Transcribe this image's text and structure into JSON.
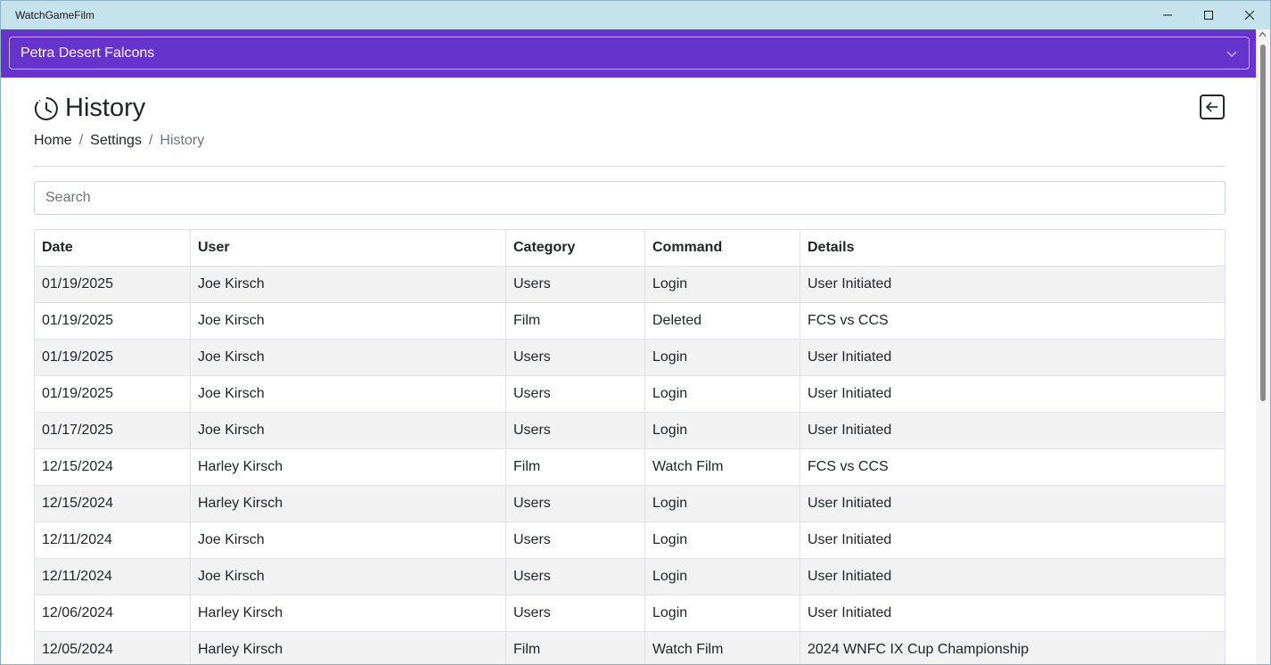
{
  "window": {
    "title": "WatchGameFilm"
  },
  "team_selector": {
    "value": "Petra Desert Falcons"
  },
  "page": {
    "title": "History"
  },
  "breadcrumb": {
    "home": "Home",
    "separator": "/",
    "settings": "Settings",
    "current": "History"
  },
  "search": {
    "placeholder": "Search",
    "value": ""
  },
  "table": {
    "headers": {
      "date": "Date",
      "user": "User",
      "category": "Category",
      "command": "Command",
      "details": "Details"
    },
    "rows": [
      {
        "date": "01/19/2025",
        "user": "Joe Kirsch",
        "category": "Users",
        "command": "Login",
        "details": "User Initiated"
      },
      {
        "date": "01/19/2025",
        "user": "Joe Kirsch",
        "category": "Film",
        "command": "Deleted",
        "details": "FCS vs CCS"
      },
      {
        "date": "01/19/2025",
        "user": "Joe Kirsch",
        "category": "Users",
        "command": "Login",
        "details": "User Initiated"
      },
      {
        "date": "01/19/2025",
        "user": "Joe Kirsch",
        "category": "Users",
        "command": "Login",
        "details": "User Initiated"
      },
      {
        "date": "01/17/2025",
        "user": "Joe Kirsch",
        "category": "Users",
        "command": "Login",
        "details": "User Initiated"
      },
      {
        "date": "12/15/2024",
        "user": "Harley Kirsch",
        "category": "Film",
        "command": "Watch Film",
        "details": "FCS vs CCS"
      },
      {
        "date": "12/15/2024",
        "user": "Harley Kirsch",
        "category": "Users",
        "command": "Login",
        "details": "User Initiated"
      },
      {
        "date": "12/11/2024",
        "user": "Joe Kirsch",
        "category": "Users",
        "command": "Login",
        "details": "User Initiated"
      },
      {
        "date": "12/11/2024",
        "user": "Joe Kirsch",
        "category": "Users",
        "command": "Login",
        "details": "User Initiated"
      },
      {
        "date": "12/06/2024",
        "user": "Harley Kirsch",
        "category": "Users",
        "command": "Login",
        "details": "User Initiated"
      },
      {
        "date": "12/05/2024",
        "user": "Harley Kirsch",
        "category": "Film",
        "command": "Watch Film",
        "details": "2024 WNFC IX Cup Championship"
      }
    ]
  },
  "colors": {
    "titlebar": "#c5e3ec",
    "teambar": "#6633cc",
    "row_stripe": "#f2f2f2"
  },
  "icons": {
    "history": "clock-history-icon",
    "back": "arrow-left-square-icon",
    "chevron": "chevron-down-icon"
  }
}
